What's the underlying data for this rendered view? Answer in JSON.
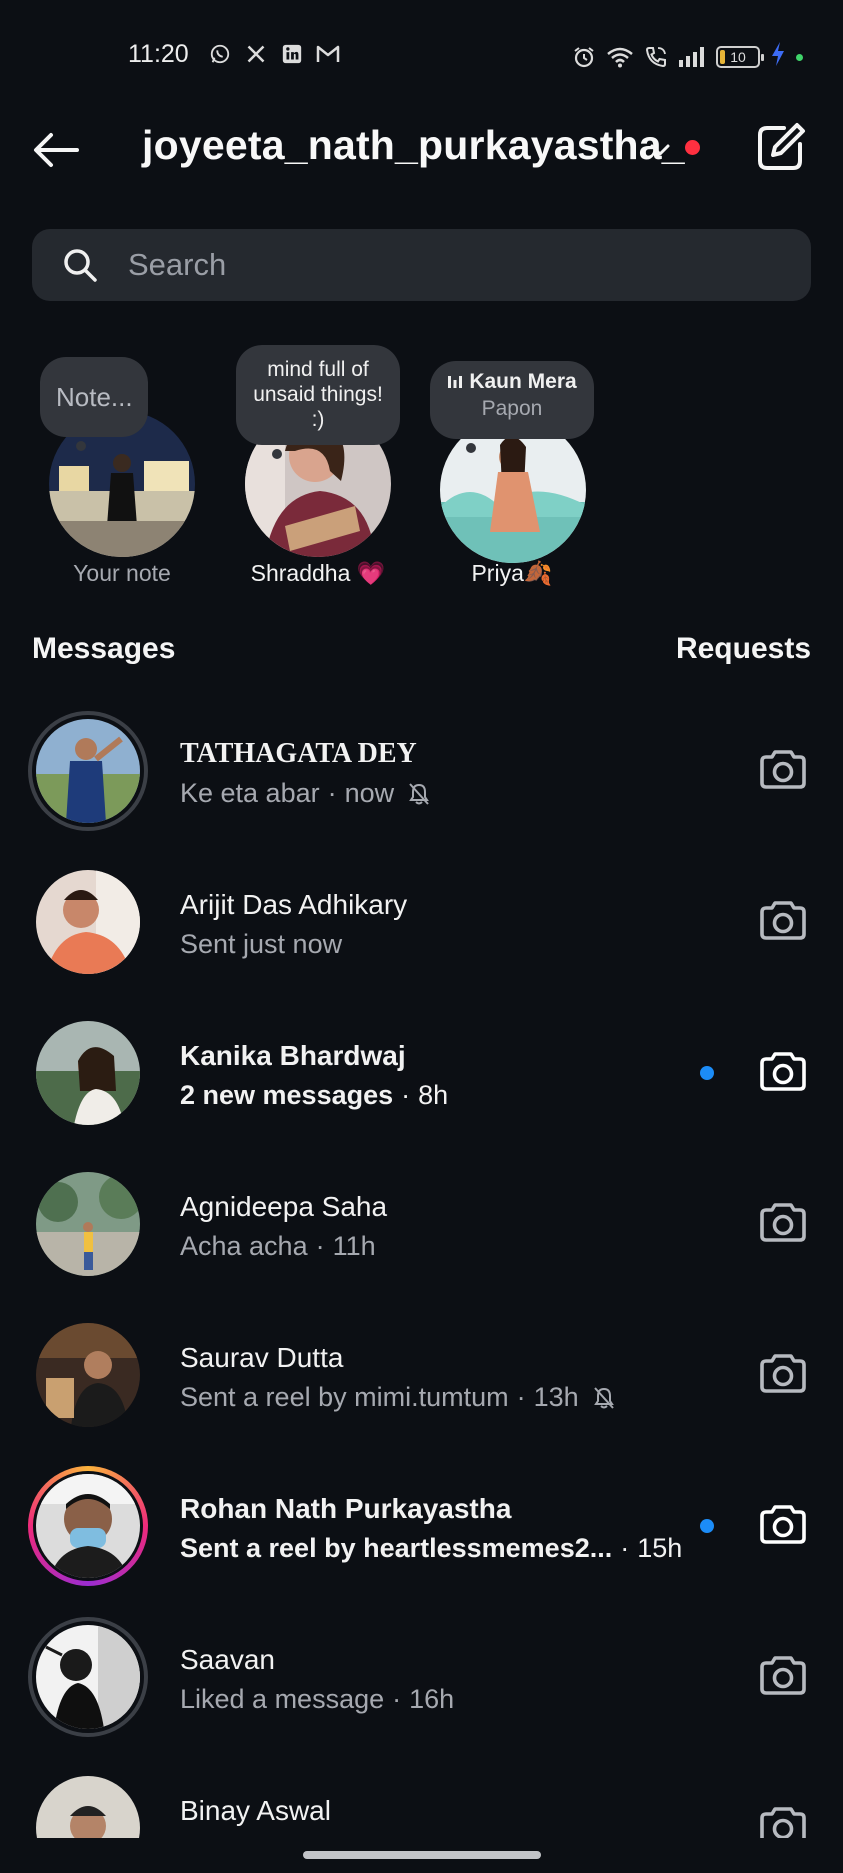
{
  "status_bar": {
    "time": "11:20",
    "battery": "10",
    "app_icons": [
      "whatsapp-icon",
      "x-icon",
      "linkedin-icon",
      "gmail-icon"
    ],
    "system_icons": [
      "alarm-icon",
      "wifi-icon",
      "wifi-call-icon",
      "signal-icon",
      "battery-icon",
      "charging-icon"
    ]
  },
  "header": {
    "account": "joyeeta_nath_purkayastha_",
    "has_notification_dot": true,
    "notification_color": "#ff3040"
  },
  "search": {
    "placeholder": "Search"
  },
  "notes": [
    {
      "bubble": "Note...",
      "label": "Your note",
      "label_muted": true
    },
    {
      "bubble": "mind full of unsaid things! :)",
      "label": "Shraddha 💗",
      "label_muted": false
    },
    {
      "music_title": "Kaun Mera",
      "music_artist": "Papon",
      "label": "Priya🍂",
      "label_muted": false
    }
  ],
  "sections": {
    "messages": "Messages",
    "requests": "Requests"
  },
  "threads": [
    {
      "name": "TATHAGATA DEY",
      "preview": "Ke eta abar",
      "time": "now",
      "muted": true,
      "unread": false
    },
    {
      "name": "Arijit Das Adhikary",
      "preview": "Sent just now",
      "time": "",
      "muted": false,
      "unread": false
    },
    {
      "name": "Kanika Bhardwaj",
      "preview": "2 new messages",
      "time": "8h",
      "muted": false,
      "unread": true
    },
    {
      "name": "Agnideepa Saha",
      "preview": "Acha acha",
      "time": "11h",
      "muted": false,
      "unread": false
    },
    {
      "name": "Saurav Dutta",
      "preview": "Sent a reel by mimi.tumtum",
      "time": "13h",
      "muted": true,
      "unread": false
    },
    {
      "name": "Rohan Nath Purkayastha",
      "preview": "Sent a reel by heartlessmemes2...",
      "time": "15h",
      "muted": false,
      "unread": true,
      "story_ring": true
    },
    {
      "name": "Saavan",
      "preview": "Liked a message",
      "time": "16h",
      "muted": false,
      "unread": false
    },
    {
      "name": "Binay Aswal",
      "preview": "",
      "time": "",
      "muted": false,
      "unread": false
    }
  ],
  "colors": {
    "background": "#0c0f14",
    "unread_dot": "#1c8cf7",
    "search_bg": "#25292f",
    "secondary_text": "#a6a9b0"
  }
}
